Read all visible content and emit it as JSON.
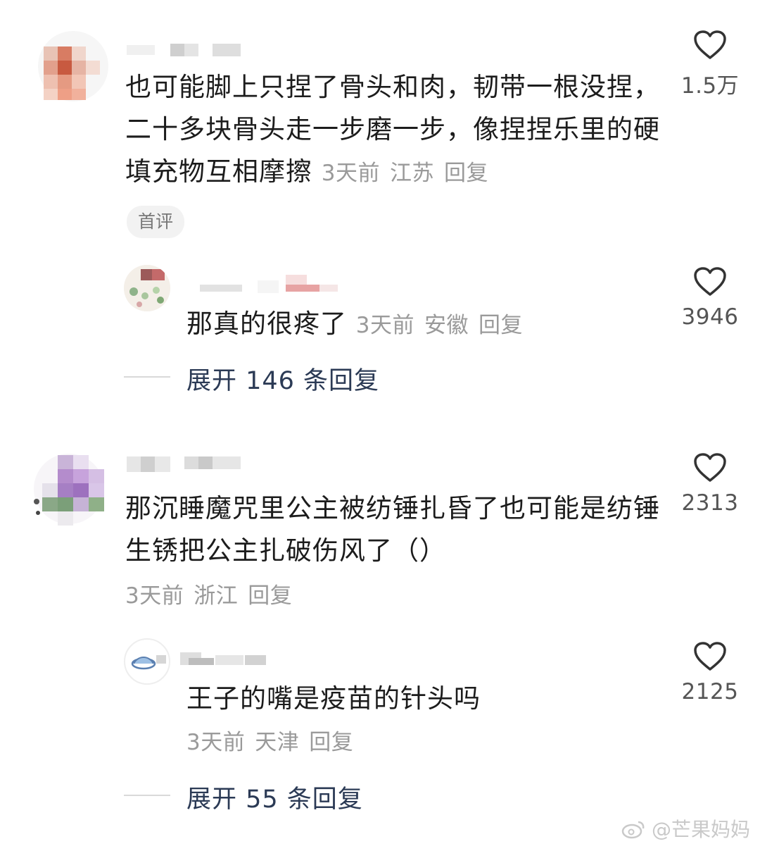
{
  "comments": [
    {
      "text": "也可能脚上只捏了骨头和肉，韧带一根没捏，二十多块骨头走一步磨一步，像捏捏乐里的硬填充物互相摩擦",
      "time": "3天前",
      "location": "江苏",
      "reply_label": "回复",
      "badge": "首评",
      "likes": "1.5万"
    },
    {
      "text": "那真的很疼了",
      "time": "3天前",
      "location": "安徽",
      "reply_label": "回复",
      "likes": "3946",
      "expand_label": "展开 146 条回复"
    },
    {
      "text": "那沉睡魔咒里公主被纺锤扎昏了也可能是纺锤生锈把公主扎破伤风了（）",
      "time": "3天前",
      "location": "浙江",
      "reply_label": "回复",
      "likes": "2313"
    },
    {
      "text": "王子的嘴是疫苗的针头吗",
      "time": "3天前",
      "location": "天津",
      "reply_label": "回复",
      "likes": "2125",
      "expand_label": "展开 55 条回复"
    }
  ],
  "watermark": "@芒果妈妈",
  "icons": {
    "like": "heart-icon",
    "weibo": "weibo-icon"
  }
}
